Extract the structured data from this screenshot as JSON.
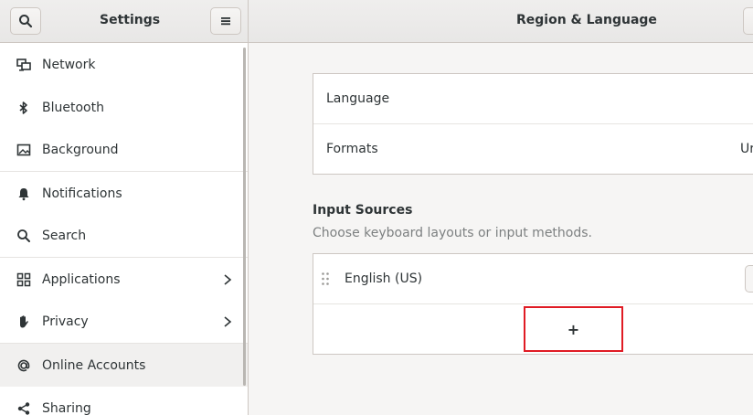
{
  "header": {
    "sidebar_title": "Settings",
    "main_title": "Region & Language"
  },
  "sidebar": {
    "items": [
      {
        "label": "Network",
        "icon": "network-icon"
      },
      {
        "label": "Bluetooth",
        "icon": "bluetooth-icon"
      },
      {
        "label": "Background",
        "icon": "background-icon"
      },
      {
        "label": "Notifications",
        "icon": "notifications-icon"
      },
      {
        "label": "Search",
        "icon": "search-icon"
      },
      {
        "label": "Applications",
        "icon": "applications-icon"
      },
      {
        "label": "Privacy",
        "icon": "privacy-icon"
      },
      {
        "label": "Online Accounts",
        "icon": "online-accounts-icon"
      },
      {
        "label": "Sharing",
        "icon": "sharing-icon"
      }
    ]
  },
  "main": {
    "language_label": "Language",
    "formats_label": "Formats",
    "formats_value_partial": "Ur",
    "input_sources_title": "Input Sources",
    "input_sources_subtitle": "Choose keyboard layouts or input methods.",
    "input_source": "English (US)",
    "add_label": "+"
  },
  "colors": {
    "highlight": "#e01b24"
  }
}
